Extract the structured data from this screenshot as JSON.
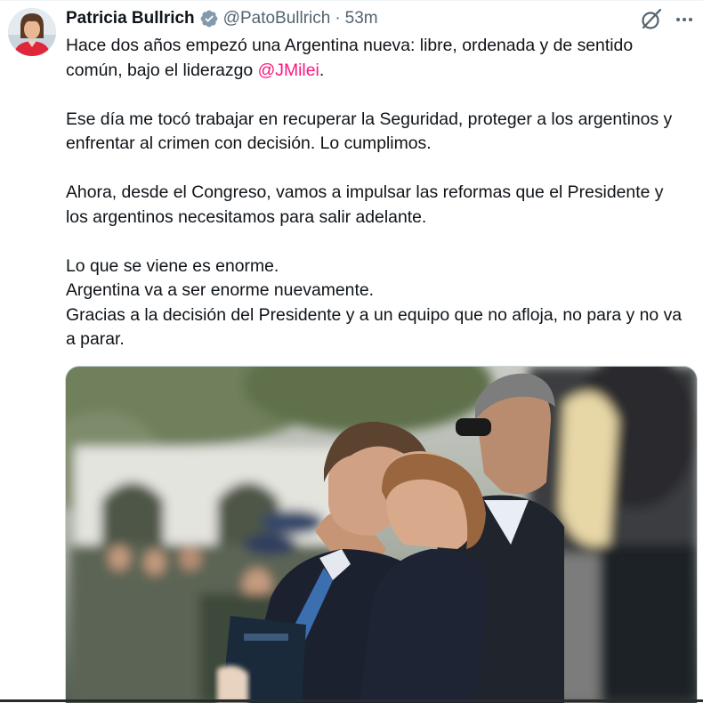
{
  "author": {
    "display_name": "Patricia Bullrich",
    "handle": "@PatoBullrich",
    "separator": "·",
    "time": "53m"
  },
  "tweet": {
    "line1_before": "Hace dos años empezó una Argentina nueva: libre, ordenada y de sentido común, bajo el liderazgo ",
    "mention": "@JMilei",
    "line1_after": ".",
    "paragraph2": "Ese día me tocó trabajar en recuperar la Seguridad, proteger a los argentinos y enfrentar al crimen con decisión. Lo cumplimos.",
    "paragraph3": "Ahora, desde el Congreso, vamos a impulsar las reformas que el Presidente y los argentinos necesitamos para salir adelante.",
    "paragraph4_line1": "Lo que se viene es enorme.",
    "paragraph4_line2": "Argentina va a ser enorme nuevamente.",
    "paragraph4_line3": "Gracias a la decisión del Presidente y a un equipo que no afloja, no para y no va a parar."
  },
  "icons": {
    "verified": "verified-badge-icon",
    "grok": "grok-icon",
    "more": "more-options-icon"
  },
  "colors": {
    "mention": "#f91880",
    "verified_badge": "#829aab",
    "secondary_text": "#536471"
  }
}
